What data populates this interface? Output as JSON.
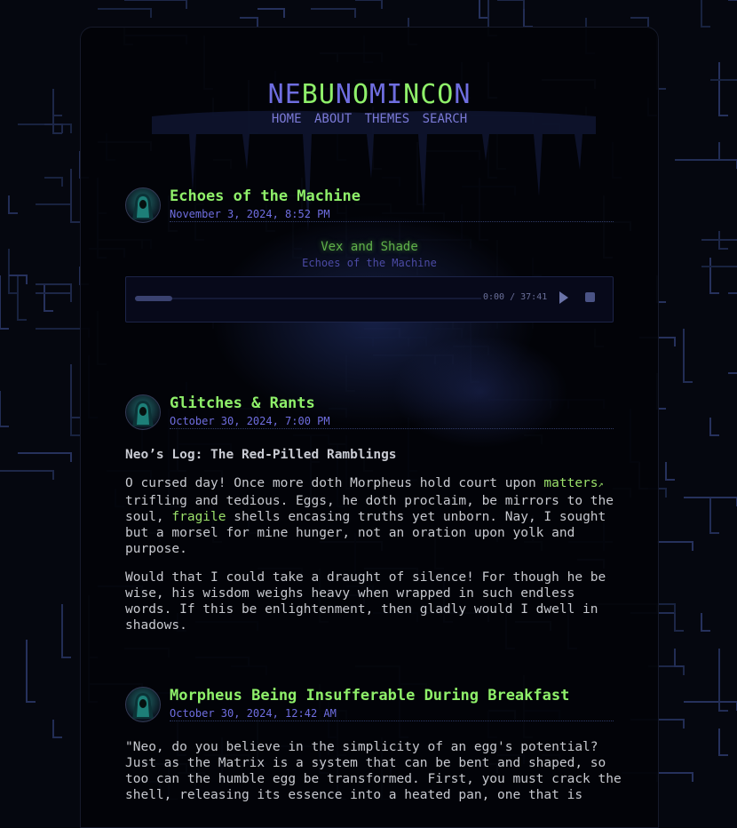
{
  "site": {
    "title_letters": [
      {
        "ch": "N",
        "color": "#6f6ee0"
      },
      {
        "ch": "E",
        "color": "#6f6ee0"
      },
      {
        "ch": "B",
        "color": "#8ff06a"
      },
      {
        "ch": "U",
        "color": "#8ff06a"
      },
      {
        "ch": "N",
        "color": "#6f6ee0"
      },
      {
        "ch": "O",
        "color": "#8ff06a"
      },
      {
        "ch": "M",
        "color": "#6f6ee0"
      },
      {
        "ch": "I",
        "color": "#6f6ee0"
      },
      {
        "ch": "N",
        "color": "#8ff06a"
      },
      {
        "ch": "C",
        "color": "#8ff06a"
      },
      {
        "ch": "O",
        "color": "#8ff06a"
      },
      {
        "ch": "N",
        "color": "#6f6ee0"
      }
    ]
  },
  "nav": {
    "home": "HOME",
    "about": "ABOUT",
    "themes": "THEMES",
    "search": "SEARCH"
  },
  "posts": [
    {
      "title": "Echoes of the Machine",
      "date": "November 3, 2024, 8:52 PM",
      "track_artist": "Vex and Shade",
      "track_album": "Echoes of the Machine",
      "player": {
        "time": "0:00 / 37:41",
        "progress": 0.1
      }
    },
    {
      "title": "Glitches & Rants",
      "date": "October 30, 2024, 7:00 PM",
      "subhead": "Neo’s Log: The Red-Pilled Ramblings",
      "p1_a": "O cursed day! Once more doth Morpheus hold court upon ",
      "p1_link1": "matters",
      "p1_b": " trifling and tedious. Eggs, he doth proclaim, be mirrors to the soul, ",
      "p1_link2": "fragile",
      "p1_c": " shells encasing truths yet unborn. Nay, I sought but a morsel for mine hunger, not an oration upon yolk and purpose.",
      "p2": "Would that I could take a draught of silence! For though he be wise, his wisdom weighs heavy when wrapped in such endless words. If this be enlightenment, then gladly would I dwell in shadows."
    },
    {
      "title": "Morpheus Being Insufferable During Breakfast",
      "date": "October 30, 2024, 12:42 AM",
      "p1": "\"Neo, do you believe in the simplicity of an egg's potential? Just as the Matrix is a system that can be bent and shaped, so too can the humble egg be transformed. First, you must crack the shell, releasing its essence into a heated pan, one that is"
    }
  ],
  "colors": {
    "accent_green": "#8ff06a",
    "accent_purple": "#6f6ee0",
    "panel_bg": "#020308"
  },
  "icons": {
    "play": "play-icon",
    "stop": "stop-icon",
    "external": "external-link-icon"
  }
}
